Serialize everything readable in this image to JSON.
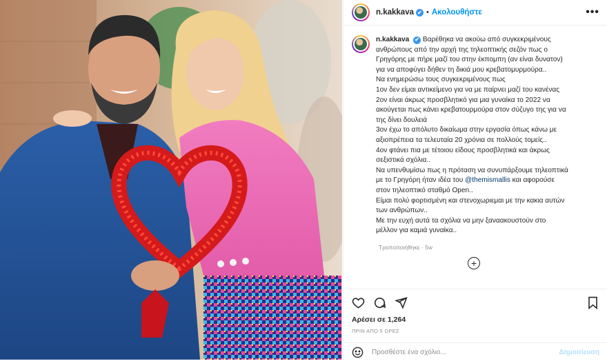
{
  "post": {
    "username": "n.kakkava",
    "verified_mark": "✔",
    "separator": "•",
    "follow_label": "Ακολουθήστε",
    "more_icon": "•••",
    "caption_lines": [
      "Βαρέθηκα να ακούω από συγκεκριμένους",
      "ανθρώπους από την αρχή της τηλεοπτικής σεζόν πως ο",
      "Γρηγόρης με πήρε μαζί του στην έκπομπη (αν είναι δυνατον)",
      "για να αποφύγει δήθεν τη δικιά μου κρεβατομυρμούρα..",
      "Να ενημερώσω τους συγκεκριμένους πως",
      "1ον δεν είμαι αντικείμενο για να με παίρνει μαζί του κανένας",
      "2ον είναι άκρως προσβλητικό για μια γυναίκα το 2022 να",
      "ακούγεται πως κάνει κρεβατουρμούρα στον σύζυγο της για να",
      "της δίνει δουλειά",
      "3ον έχω το απόλυτο δικαίωμα στην εργασία όπως κάνω με",
      "αξιοπρέπεια τα τελευταία 20 χρόνια σε πολλούς τομείς..",
      "4ον φτάνει πια με τέτοιου είδους προσβλητικά και άκρως",
      "σεξιστικά σχόλια..",
      "Να υπενθυμίσω πως η πρόταση να συνυπάρξουμε τηλεοπτικά",
      "__MENTION__",
      "στον τηλεοπτικό σταθμό Open..",
      "Είμαι πολύ φορτισμένη και στενοχωριεμαι με την κακια αυτών",
      "των ανθρώπων..",
      "Με την ευχή αυτά τα σχόλια να μην ξαναακουστούν στο",
      "μέλλον για καμιά γυναίκα.."
    ],
    "mention_line": {
      "before": "με το Γρηγόρη ήταν ιδέα του ",
      "mention": "@themismallis",
      "after": " και αφορούσε"
    },
    "edited_label": "Τροποποιήθηκε · 5w",
    "load_more_icon": "+",
    "likes_label": "Αρέσει σε 1,264",
    "time_label": "ΠΡΙΝ ΑΠΟ 5 ΩΡΕΣ",
    "comment_placeholder": "Προσθέστε ένα σχόλιο...",
    "post_label": "Δημοσίευση",
    "accent_color": "#0095f6"
  },
  "icons": [
    "heart-icon",
    "comment-icon",
    "share-icon",
    "bookmark-icon",
    "emoji-icon",
    "plus-circle-icon",
    "verified-badge-icon"
  ]
}
